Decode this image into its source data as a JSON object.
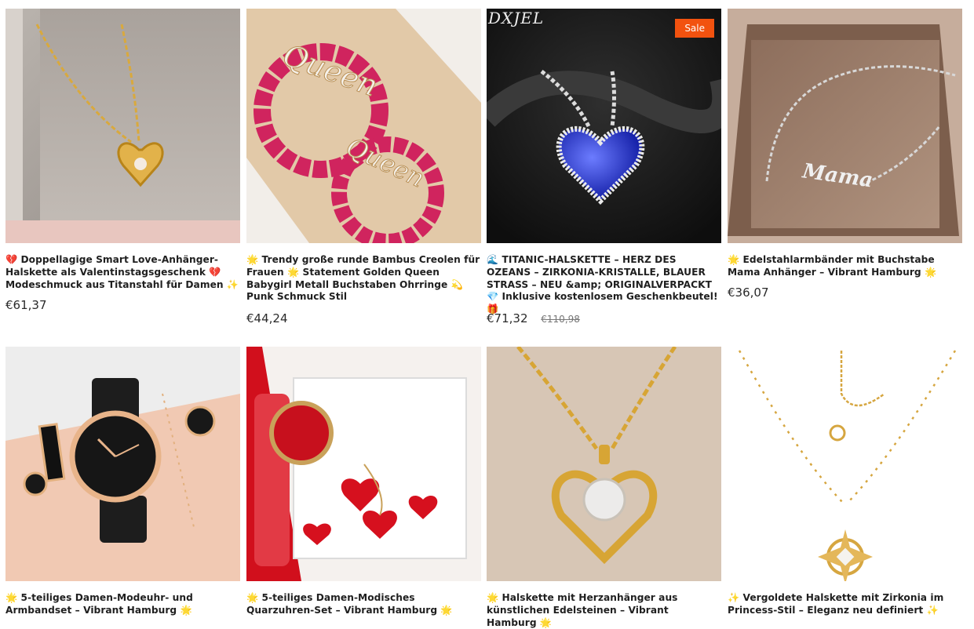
{
  "products": [
    {
      "title": "💔 Doppellagige Smart Love-Anhänger-Halskette als Valentinstagsgeschenk 💔 Modeschmuck aus Titanstahl für Damen ✨",
      "price": "€61,37",
      "image_icon": "gold-heart-necklace-image"
    },
    {
      "title": "🌟 Trendy große runde Bambus Creolen für Frauen 🌟 Statement Golden Queen Babygirl Metall Buchstaben Ohrringe 💫 Punk Schmuck Stil",
      "price": "€44,24",
      "image_icon": "queen-hoop-earrings-image"
    },
    {
      "title": "🌊 TITANIC-HALSKETTE – HERZ DES OZEANS – ZIRKONIA-KRISTALLE, BLAUER STRASS – NEU &amp; ORIGINALVERPACKT 💎 Inklusive kostenlosem Geschenkbeutel! 🎁",
      "price": "€71,32",
      "compare_price": "€110,98",
      "badge": "Sale",
      "brand_mark": "DXJEL",
      "image_icon": "blue-heart-necklace-image"
    },
    {
      "title": "🌟 Edelstahlarmbänder mit Buchstabe Mama Anhänger – Vibrant Hamburg 🌟",
      "price": "€36,07",
      "image_icon": "mama-bracelet-image"
    },
    {
      "title": "🌟 5-teiliges Damen-Modeuhr- und Armbandset – Vibrant Hamburg 🌟",
      "image_icon": "watch-bracelet-set-image"
    },
    {
      "title": "🌟 5-teiliges Damen-Modisches Quarzuhren-Set – Vibrant Hamburg 🌟",
      "image_icon": "red-watch-set-image"
    },
    {
      "title": "🌟 Halskette mit Herzanhänger aus künstlichen Edelsteinen – Vibrant Hamburg 🌟",
      "image_icon": "gold-heart-pendant-image"
    },
    {
      "title": "✨ Vergoldete Halskette mit Zirkonia im Princess-Stil – Eleganz neu definiert ✨",
      "image_icon": "sun-pendant-necklace-image"
    }
  ],
  "colors": {
    "sale_badge": "#f2520f",
    "text": "#1f1f1f"
  }
}
